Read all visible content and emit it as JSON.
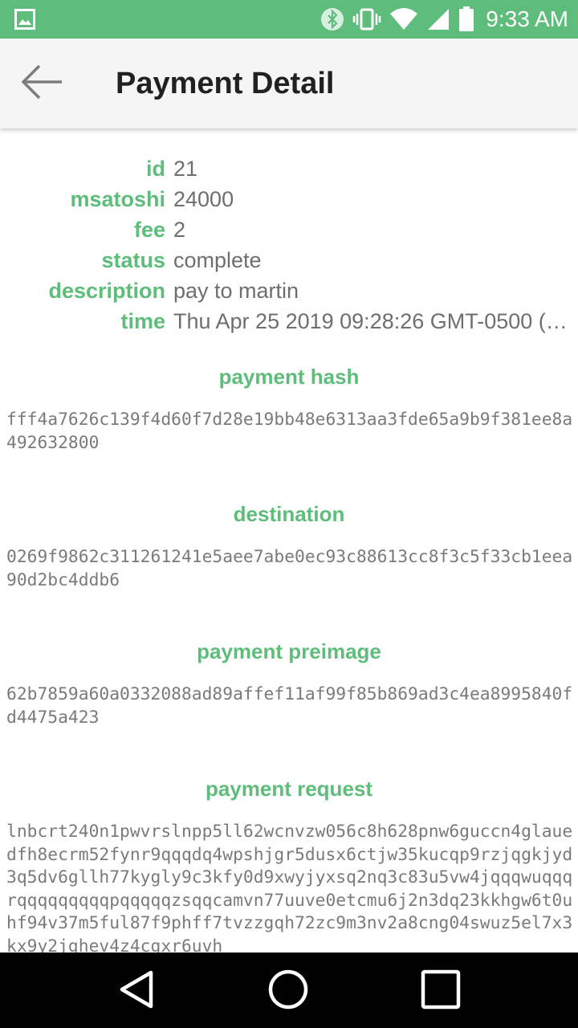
{
  "status_bar": {
    "time": "9:33 AM",
    "icons": [
      "image-icon",
      "bluetooth-icon",
      "vibrate-icon",
      "wifi-icon",
      "signal-icon",
      "battery-icon"
    ]
  },
  "app_bar": {
    "title": "Payment Detail",
    "back_icon": "arrow-back-icon"
  },
  "details": {
    "rows": [
      {
        "key": "id",
        "value": "21"
      },
      {
        "key": "msatoshi",
        "value": "24000"
      },
      {
        "key": "fee",
        "value": "2"
      },
      {
        "key": "status",
        "value": "complete"
      },
      {
        "key": "description",
        "value": "pay to martin"
      },
      {
        "key": "time",
        "value": "Thu Apr 25 2019 09:28:26 GMT-0500 (…"
      }
    ]
  },
  "sections": {
    "payment_hash": {
      "title": "payment hash",
      "value": "fff4a7626c139f4d60f7d28e19bb48e6313aa3fde65a9b9f381ee8a492632800"
    },
    "destination": {
      "title": "destination",
      "value": "0269f9862c311261241e5aee7abe0ec93c88613cc8f3c5f33cb1eea90d2bc4ddb6"
    },
    "payment_preimage": {
      "title": "payment preimage",
      "value": "62b7859a60a0332088ad89affef11af99f85b869ad3c4ea8995840fd4475a423"
    },
    "payment_request": {
      "title": "payment request",
      "value": "lnbcrt240n1pwvrslnpp5ll62wcnvzw056c8h628pnw6guccn4glauedfh8ecrm52fynr9qqqdq4wpshjgr5dusx6ctjw35kucqp9rzjqgkjyd3q5dv6gllh77kygly9c3kfy0d9xwyjyxsq2nq3c83u5vw4jqqqwuqqqrqqqqqqqqqpqqqqqzsqqcamvn77uuve0etcmu6j2n3dq23kkhgw6t0uhf94v37m5ful87f9phff7tvzzgqh72zc9m3nv2a8cng04swuz5el7x3kx9y2jghev4z4cgxr6uvh"
    }
  },
  "nav_bar": {
    "buttons": [
      "back-triangle-icon",
      "home-circle-icon",
      "recents-square-icon"
    ]
  },
  "colors": {
    "accent": "#5ebd7a",
    "value_text": "#6e6e6e",
    "mono_text": "#7a7a7a",
    "app_bar_bg": "#f5f5f5",
    "title_text": "#212121"
  }
}
